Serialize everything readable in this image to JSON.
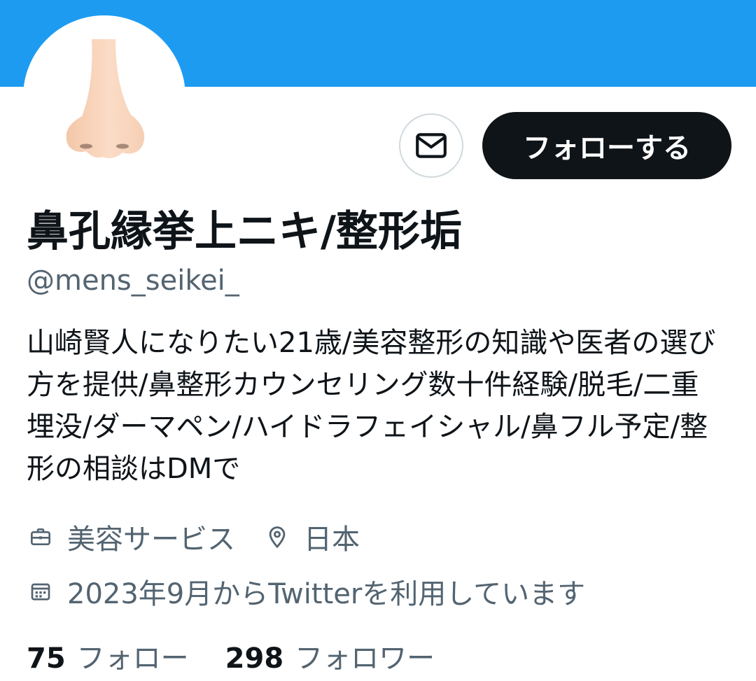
{
  "profile": {
    "display_name": "鼻孔縁挙上ニキ/整形垢",
    "handle": "@mens_seikei_",
    "bio": "山崎賢人になりたい21歳/美容整形の知識や医者の選び方を提供/鼻整形カウンセリング数十件経験/脱毛/二重埋没/ダーマペン/ハイドラフェイシャル/鼻フル予定/整形の相談はDMで",
    "category": "美容サービス",
    "location": "日本",
    "joined": "2023年9月からTwitterを利用しています"
  },
  "actions": {
    "follow_label": "フォローする",
    "dm_icon": "envelope-icon"
  },
  "stats": {
    "following_count": "75",
    "following_label": "フォロー",
    "followers_count": "298",
    "followers_label": "フォロワー"
  },
  "icons": {
    "category": "briefcase-icon",
    "location": "location-pin-icon",
    "joined": "calendar-icon"
  },
  "colors": {
    "banner": "#1d9bf0",
    "primary_text": "#0f1419",
    "secondary_text": "#536471",
    "button_bg": "#0f1419",
    "border": "#cfd9de"
  }
}
